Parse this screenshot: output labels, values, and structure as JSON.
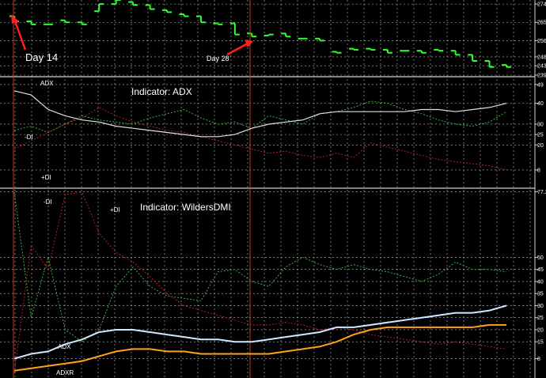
{
  "colors": {
    "background": "#000000",
    "grid": "#bfbfbf",
    "marker_line": "#c0392b",
    "price_bar": "#33ff33",
    "adx_line": "#e0e0e0",
    "di_minus": "#3cb043",
    "di_plus": "#b22222",
    "wilders_adx": "#cfe8ff",
    "adxr": "#ffa21a",
    "arrow": "#ff2020"
  },
  "annotations": {
    "day14": "Day 14",
    "day28": "Day 28"
  },
  "chart_data": [
    {
      "type": "line",
      "panel": "price",
      "bar_style": "open-close ticks (green)",
      "x": [
        1,
        2,
        3,
        4,
        5,
        6,
        7,
        8,
        9,
        10,
        11,
        12,
        13,
        14,
        15,
        16,
        17,
        18,
        19,
        20,
        21,
        22,
        23,
        24,
        25,
        26,
        27,
        28,
        29,
        30
      ],
      "open": [
        268,
        265.5,
        264,
        266,
        265,
        270.5,
        274,
        275,
        273.5,
        271,
        269,
        268,
        264.5,
        264.5,
        259.5,
        258.5,
        259.5,
        257,
        257,
        250.5,
        252,
        252,
        251.5,
        251,
        251,
        251.5,
        251,
        249,
        246,
        244
      ],
      "close": [
        265.5,
        264,
        264,
        265,
        264,
        274,
        276,
        273.5,
        271.5,
        270,
        268,
        265,
        264,
        259,
        258,
        259,
        258,
        257,
        256,
        250,
        251.5,
        251.5,
        250,
        251,
        250,
        251,
        249,
        246,
        243,
        243
      ],
      "y_ticks": [
        "274.",
        "265.",
        "256.",
        "248.",
        "243.6",
        "239."
      ],
      "ylim": [
        239,
        276
      ]
    },
    {
      "type": "line",
      "panel": "ADX indicator",
      "title": "Indicator: ADX",
      "series_labels": {
        "adx": "ADX",
        "minus_di": "-DI",
        "plus_di": "+DI"
      },
      "x": [
        1,
        2,
        3,
        4,
        5,
        6,
        7,
        8,
        9,
        10,
        11,
        12,
        13,
        14,
        15,
        16,
        17,
        18,
        19,
        20,
        21,
        22,
        23,
        24,
        25,
        26,
        27,
        28,
        29,
        30
      ],
      "series": [
        {
          "name": "ADX",
          "values": [
            46,
            44,
            37,
            34,
            32,
            31,
            29,
            28,
            27,
            26,
            25,
            24,
            24,
            25,
            28,
            30,
            31,
            32,
            35,
            36,
            36,
            36,
            36,
            36,
            37,
            37,
            36,
            37,
            38,
            40
          ]
        },
        {
          "name": "-DI",
          "values": [
            27,
            29,
            26,
            30,
            34,
            32,
            31,
            30,
            33,
            35,
            37,
            33,
            30,
            31,
            28,
            34,
            32,
            30,
            35,
            36,
            38,
            41,
            40,
            37,
            35,
            32,
            30,
            29,
            31,
            36
          ]
        },
        {
          "name": "+DI",
          "values": [
            18,
            22,
            26,
            30,
            33,
            38,
            34,
            31,
            29,
            27,
            26,
            24,
            22,
            20,
            18,
            16,
            17,
            15,
            14,
            16,
            14,
            21,
            19,
            17,
            15,
            13,
            12,
            11,
            10,
            8
          ]
        }
      ],
      "y_ticks": [
        "49",
        "40",
        "30",
        "25",
        "20",
        "8"
      ],
      "ylim": [
        0,
        52
      ]
    },
    {
      "type": "line",
      "panel": "WildersDMI indicator",
      "title": "Indicator: WildersDMI",
      "series_labels": {
        "adx": "ADX",
        "adxr": "ADXR",
        "minus_di": "-DI",
        "plus_di": "+DI"
      },
      "x": [
        1,
        2,
        3,
        4,
        5,
        6,
        7,
        8,
        9,
        10,
        11,
        12,
        13,
        14,
        15,
        16,
        17,
        18,
        19,
        20,
        21,
        22,
        23,
        24,
        25,
        26,
        27,
        28,
        29,
        30
      ],
      "series": [
        {
          "name": "ADX",
          "values": [
            8,
            10,
            11,
            14,
            16,
            19,
            20,
            20,
            19,
            18,
            17,
            16,
            16,
            15,
            15,
            16,
            17,
            18,
            19,
            21,
            21,
            22,
            23,
            24,
            25,
            26,
            27,
            27,
            28,
            30
          ]
        },
        {
          "name": "ADXR",
          "values": [
            3,
            4,
            5,
            6,
            7,
            9,
            11,
            12,
            12,
            11,
            11,
            10,
            10,
            10,
            10,
            10,
            11,
            12,
            13,
            15,
            18,
            20,
            21,
            21,
            21,
            21,
            21,
            21,
            22,
            22
          ]
        },
        {
          "name": "-DI",
          "values": [
            77,
            25,
            50,
            20,
            15,
            20,
            38,
            46,
            38,
            34,
            33,
            32,
            44,
            45,
            40,
            38,
            46,
            50,
            47,
            45,
            47,
            45,
            44,
            42,
            40,
            43,
            48,
            45,
            45,
            44
          ]
        },
        {
          "name": "+DI",
          "values": [
            2,
            55,
            45,
            76,
            77,
            60,
            52,
            48,
            42,
            35,
            30,
            28,
            26,
            24,
            22,
            22,
            23,
            22,
            20,
            21,
            20,
            18,
            17,
            16,
            15,
            14,
            15,
            14,
            13,
            12
          ]
        }
      ],
      "y_ticks": [
        "77.2",
        "50",
        "45",
        "40",
        "35",
        "30",
        "25",
        "20",
        "15",
        "8"
      ],
      "ylim": [
        0,
        78
      ]
    }
  ]
}
